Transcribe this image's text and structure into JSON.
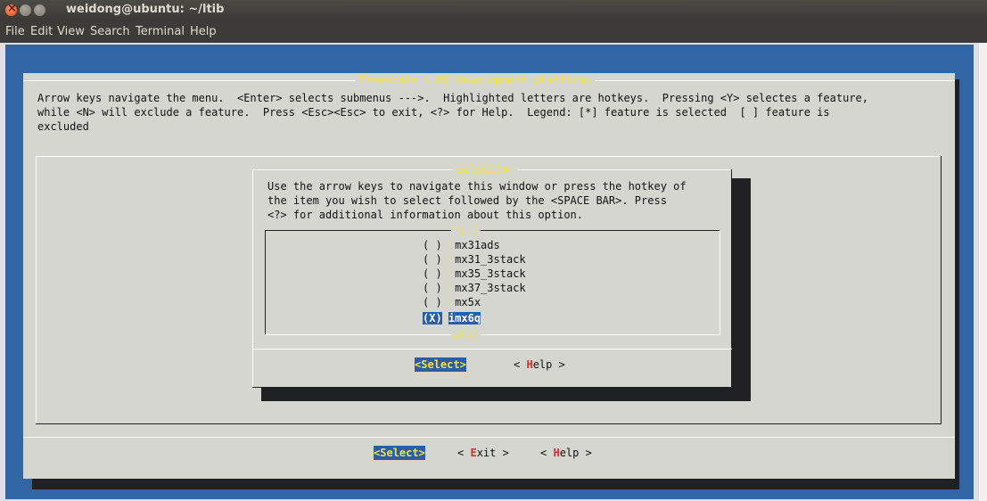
{
  "window": {
    "title": "weidong@ubuntu: ~/ltib"
  },
  "menu": [
    "File",
    "Edit",
    "View",
    "Search",
    "Terminal",
    "Help"
  ],
  "main": {
    "title": "Freescale i.MX development platforms",
    "help1": "Arrow keys navigate the menu.  <Enter> selects submenus --->.  Highlighted letters are hotkeys.  Pressing <Y> selectes a feature,",
    "help2": "while <N> will exclude a feature.  Press <Esc><Esc> to exit, <?> for Help.  Legend: [*] feature is selected  [ ] feature is",
    "help3": "excluded",
    "buttons": {
      "select": "<Select>",
      "exit_pre": "< ",
      "exit_hk": "E",
      "exit_rest": "xit >",
      "help_pre": "< ",
      "help_hk": "H",
      "help_rest": "elp >"
    }
  },
  "dialog": {
    "title": "Selection",
    "text1": "Use the arrow keys to navigate this window or press the hotkey of",
    "text2": "the item you wish to select followed by the <SPACE BAR>. Press",
    "text3": "<?> for additional information about this option.",
    "scroll_up": "^(-)",
    "scroll_down": "v(+)",
    "items": [
      {
        "mark": "( )",
        "label": "mx31ads"
      },
      {
        "mark": "( )",
        "label": "mx31_3stack"
      },
      {
        "mark": "( )",
        "label": "mx35_3stack"
      },
      {
        "mark": "( )",
        "label": "mx37_3stack"
      },
      {
        "mark": "( )",
        "label": "mx5x"
      },
      {
        "mark": "(X)",
        "label": "imx6q"
      }
    ],
    "buttons": {
      "select": "<Select>",
      "help_pre": "< ",
      "help_hk": "H",
      "help_rest": "elp >"
    }
  }
}
